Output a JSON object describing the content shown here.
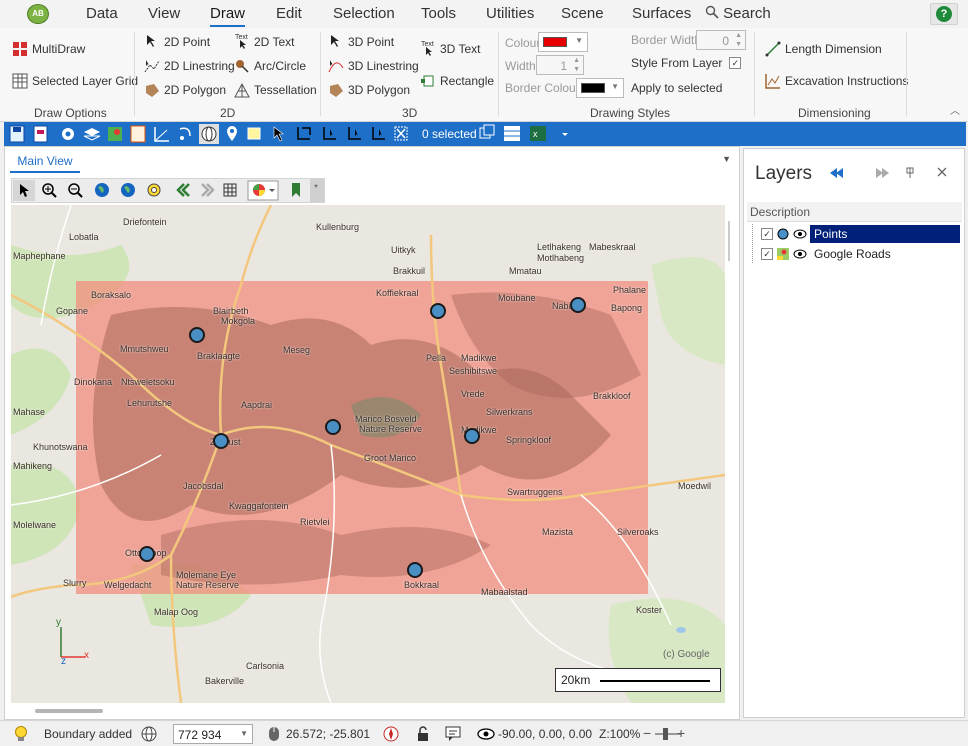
{
  "menu": {
    "items": [
      "Data",
      "View",
      "Draw",
      "Edit",
      "Selection",
      "Tools",
      "Utilities",
      "Scene",
      "Surfaces"
    ],
    "search": "Search",
    "logo": "AB"
  },
  "ribbon": {
    "draw_options": {
      "multidraw": "MultiDraw",
      "selected_layer_grid": "Selected Layer Grid",
      "label": "Draw Options"
    },
    "two_d": {
      "point": "2D Point",
      "linestring": "2D Linestring",
      "polygon": "2D Polygon",
      "text": "2D Text",
      "arc": "Arc/Circle",
      "tessellation": "Tessellation",
      "label": "2D",
      "text_icon": "Text"
    },
    "three_d": {
      "point": "3D Point",
      "linestring": "3D Linestring",
      "polygon": "3D Polygon",
      "text": "3D Text",
      "rectangle": "Rectangle",
      "label": "3D",
      "text_icon": "Text"
    },
    "styles": {
      "colour": "Colour",
      "width": "Width",
      "width_value": "1",
      "border_colour": "Border Colour",
      "border_width": "Border Width",
      "border_width_value": "0",
      "style_from_layer": "Style From Layer",
      "apply": "Apply to selected",
      "label": "Drawing Styles",
      "colour_hex": "#e60000",
      "border_colour_hex": "#000000"
    },
    "dimensioning": {
      "length": "Length Dimension",
      "excavation": "Excavation Instructions",
      "label": "Dimensioning"
    }
  },
  "toolbar": {
    "selected": "0 selected"
  },
  "map_view": {
    "tab": "Main View",
    "more": "*",
    "copyright": "(c) Google",
    "scale": "20km",
    "axes": {
      "y": "y",
      "x": "x",
      "z": "z"
    },
    "labels": [
      {
        "t": "Driefontein"
      },
      {
        "t": "Lobatla"
      },
      {
        "t": "Maphephane"
      },
      {
        "t": "Kullenburg"
      },
      {
        "t": "Uitkyk"
      },
      {
        "t": "Brakkuil"
      },
      {
        "t": "Mmatau"
      },
      {
        "t": "Letlhakeng"
      },
      {
        "t": "Motlhabeng"
      },
      {
        "t": "Mabeskraal"
      },
      {
        "t": "Boraksalo"
      },
      {
        "t": "Gopane"
      },
      {
        "t": "Blairbeth"
      },
      {
        "t": "Mokgola"
      },
      {
        "t": "Koffiekraal"
      },
      {
        "t": "Moubane"
      },
      {
        "t": "Phalane"
      },
      {
        "t": "Nabad"
      },
      {
        "t": "Bapong"
      },
      {
        "t": "Mmutshweu"
      },
      {
        "t": "Braklaagte"
      },
      {
        "t": "Meseg"
      },
      {
        "t": "Pella"
      },
      {
        "t": "Madikwe"
      },
      {
        "t": "Seshibitswe"
      },
      {
        "t": "Dinokana"
      },
      {
        "t": "Ntsweletsoku"
      },
      {
        "t": "Vrede"
      },
      {
        "t": "Brakkloof"
      },
      {
        "t": "Lehurutshe"
      },
      {
        "t": "Aapdrai"
      },
      {
        "t": "Silwerkrans"
      },
      {
        "t": "Madikwe"
      },
      {
        "t": "Marico Bosveld"
      },
      {
        "t": "Nature Reserve"
      },
      {
        "t": "Zeerust"
      },
      {
        "t": "Springkloof"
      },
      {
        "t": "Khunotswana"
      },
      {
        "t": "Groot Marico"
      },
      {
        "t": "Jacobsdal"
      },
      {
        "t": "Swartruggens"
      },
      {
        "t": "Moedwil"
      },
      {
        "t": "Kwaggafontein"
      },
      {
        "t": "Rietvlei"
      },
      {
        "t": "Mazista"
      },
      {
        "t": "Silveroaks"
      },
      {
        "t": "Ottoshoop"
      },
      {
        "t": "Slurry"
      },
      {
        "t": "Welgedacht"
      },
      {
        "t": "Molemane Eye"
      },
      {
        "t": "Nature Reserve"
      },
      {
        "t": "Bokkraal"
      },
      {
        "t": "Mabaalstad"
      },
      {
        "t": "Malap Oog"
      },
      {
        "t": "Koster"
      },
      {
        "t": "Carlsonia"
      },
      {
        "t": "Bakerville"
      },
      {
        "t": "Mahikeng"
      },
      {
        "t": "Molelwane"
      },
      {
        "t": "Mahase"
      }
    ]
  },
  "layers": {
    "title": "Layers",
    "description": "Description",
    "items": [
      {
        "name": "Points"
      },
      {
        "name": "Google Roads"
      }
    ]
  },
  "status": {
    "message": "Boundary added",
    "scale": "772 934",
    "coords": "26.572; -25.801",
    "rotation": "-90.00, 0.00, 0.00",
    "zoom": "Z:100%"
  }
}
